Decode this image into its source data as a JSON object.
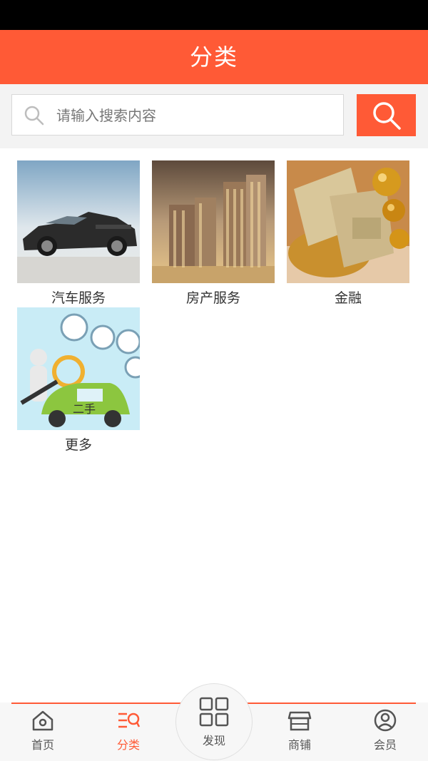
{
  "header": {
    "title": "分类"
  },
  "search": {
    "placeholder": "请输入搜索内容"
  },
  "categories": [
    {
      "label": "汽车服务",
      "icon": "car-photo"
    },
    {
      "label": "房产服务",
      "icon": "buildings-photo"
    },
    {
      "label": "金融",
      "icon": "money-photo"
    },
    {
      "label": "更多",
      "icon": "used-car-illustration"
    }
  ],
  "tabs": {
    "home": "首页",
    "category": "分类",
    "discover": "发现",
    "shop": "商铺",
    "member": "会员"
  },
  "colors": {
    "accent": "#ff5a36"
  }
}
